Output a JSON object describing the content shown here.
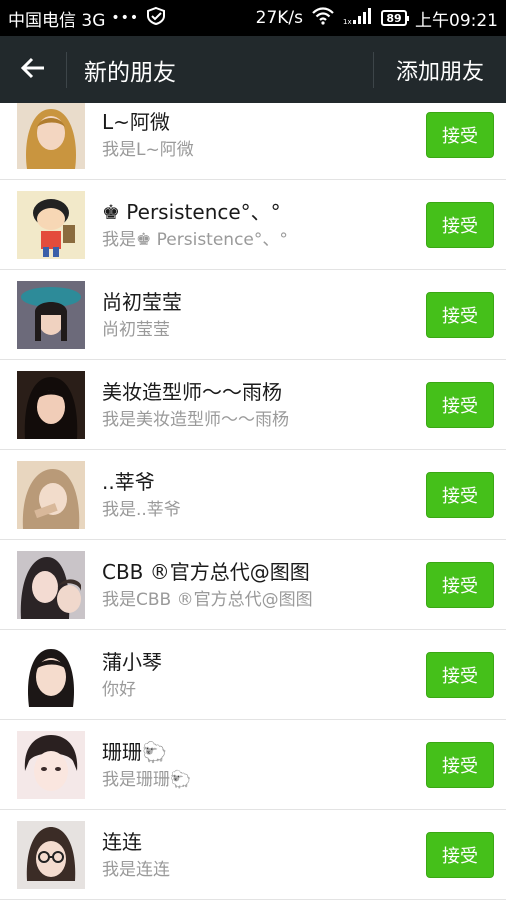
{
  "status_bar": {
    "carrier": "中国电信 3G",
    "dots": "•••",
    "speed": "27K/s",
    "battery": "89",
    "time": "上午09:21"
  },
  "header": {
    "title": "新的朋友",
    "add_label": "添加朋友"
  },
  "colors": {
    "accent": "#45c01a",
    "header_bg": "#22292c"
  },
  "friends": [
    {
      "name": "L~阿微",
      "message": "我是L~阿微",
      "action": "接受"
    },
    {
      "name": "♚ Persistence°、°",
      "message": "我是♚ Persistence°、°",
      "action": "接受"
    },
    {
      "name": "尚初莹莹",
      "message": "尚初莹莹",
      "action": "接受"
    },
    {
      "name": "美妆造型师～～雨杨",
      "message": "我是美妆造型师～～雨杨",
      "action": "接受"
    },
    {
      "name": "..莘爷",
      "message": "我是..莘爷",
      "action": "接受"
    },
    {
      "name": "CBB ®官方总代@图图",
      "message": "我是CBB ®官方总代@图图",
      "action": "接受"
    },
    {
      "name": "蒲小琴",
      "message": "你好",
      "action": "接受"
    },
    {
      "name": "珊珊🐑",
      "message": "我是珊珊🐑",
      "action": "接受"
    },
    {
      "name": "连连",
      "message": "我是连连",
      "action": "接受"
    }
  ]
}
